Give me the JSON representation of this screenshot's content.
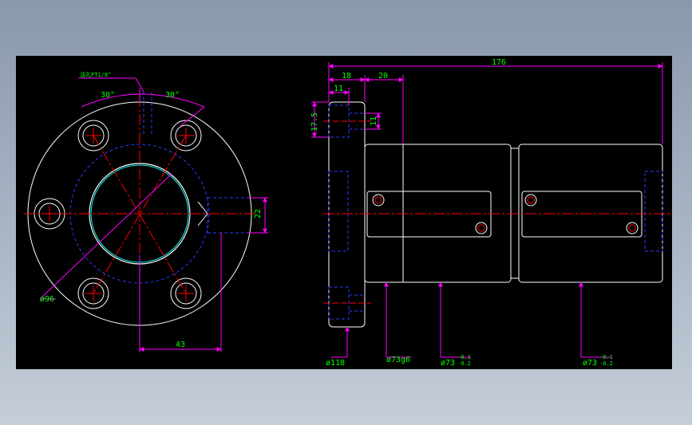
{
  "colors": {
    "background": "#000000",
    "outline": "#ffffff",
    "centerline": "#ff0000",
    "dimension_line": "#ff00ff",
    "dimension_text": "#00ff00",
    "hidden": "#0000ff",
    "bore": "#00ffff"
  },
  "front_view": {
    "note": "油孔PT1/8\"",
    "angle_left": "30°",
    "angle_right": "30°",
    "pcd_dia": "ø96",
    "offset": "43",
    "port_height": "22"
  },
  "side_view": {
    "overall_length": "176",
    "flange_thickness": "18",
    "cbore_depth": "11",
    "step_length": "20",
    "hole_pos": "17.5",
    "cbore_dia": "11",
    "flange_dia": "ø118",
    "pilot_dia": "ø73g6",
    "body_dia_1": "ø73",
    "body_dia_1_tol_upper": "-0.1",
    "body_dia_1_tol_lower": "-0.2",
    "body_dia_2": "ø73",
    "body_dia_2_tol_upper": "-0.1",
    "body_dia_2_tol_lower": "-0.2"
  }
}
